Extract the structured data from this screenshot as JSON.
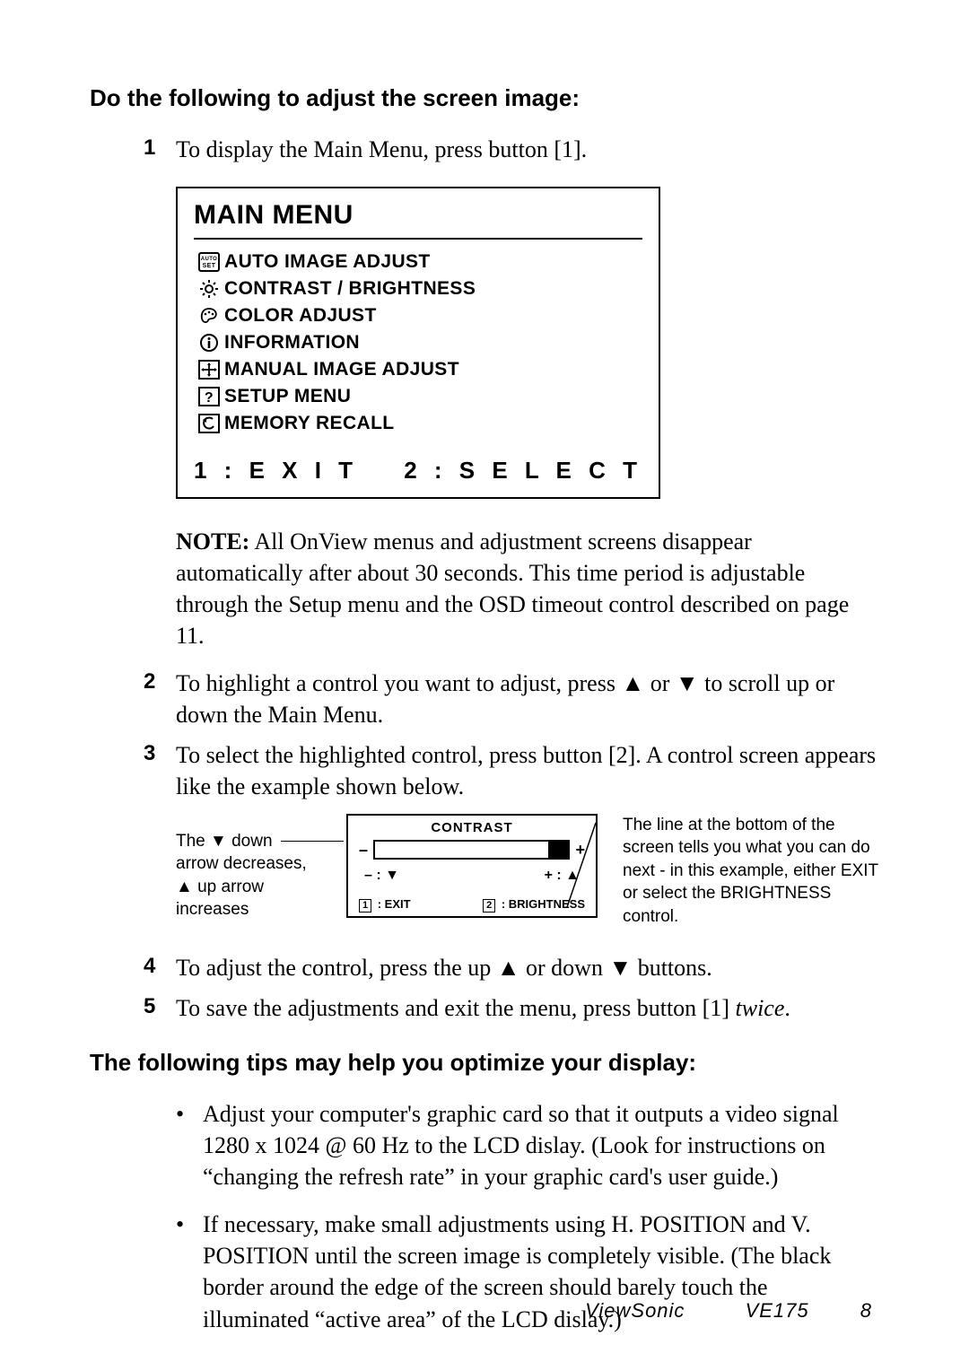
{
  "heading1": "Do the following to adjust the screen image:",
  "step1": {
    "n": "1",
    "text": "To display the Main Menu, press button [1]."
  },
  "menu": {
    "title": "MAIN MENU",
    "items": [
      {
        "icon": "autoset-icon",
        "label": "AUTO IMAGE ADJUST"
      },
      {
        "icon": "brightness-icon",
        "label": "CONTRAST / BRIGHTNESS"
      },
      {
        "icon": "palette-icon",
        "label": "COLOR ADJUST"
      },
      {
        "icon": "info-icon",
        "label": "INFORMATION"
      },
      {
        "icon": "move-icon",
        "label": "MANUAL IMAGE ADJUST"
      },
      {
        "icon": "help-icon",
        "label": "SETUP MENU"
      },
      {
        "icon": "recall-icon",
        "label": "MEMORY RECALL"
      }
    ],
    "foot_left": "1 : E X I T",
    "foot_right": "2 : S E L E C T"
  },
  "note_label": "NOTE:",
  "note_text": " All OnView menus and adjustment screens disappear automatically after about 30 seconds. This time period is adjustable through the Setup menu and the OSD timeout control described on page 11.",
  "step2": {
    "n": "2",
    "pre": "To highlight a control you want to adjust, press ",
    "mid": " or ",
    "post": " to scroll up or down the Main Menu."
  },
  "step3": {
    "n": "3",
    "text": "To select the highlighted control, press button [2]. A control screen appears like the example shown below."
  },
  "contrast": {
    "left_l1": "The ▼ down",
    "left_l2": "arrow decreases,",
    "left_l3": "▲ up arrow",
    "left_l4": "increases",
    "title": "CONTRAST",
    "minus": "–",
    "plus": "+",
    "hint_minus": "– : ▼",
    "hint_plus": "+ : ▲",
    "foot_exit_key": "1",
    "foot_exit": " : EXIT",
    "foot_br_key": "2",
    "foot_br": " : BRIGHTNESS",
    "right": "The line at the bottom of the screen tells you what you can do next - in this example, either EXIT or select the BRIGHTNESS control."
  },
  "step4": {
    "n": "4",
    "pre": "To adjust the control, press the up ",
    "mid": " or down ",
    "post": " buttons."
  },
  "step5": {
    "n": "5",
    "pre": "To save the adjustments and exit the menu, press button [1] ",
    "ital": "twice",
    "post": "."
  },
  "heading2": "The following tips may help you optimize your display:",
  "tip1": "Adjust your computer's graphic card so that it outputs a video signal 1280 x 1024 @ 60 Hz to the LCD dislay. (Look for instructions on “changing the refresh rate” in your graphic card's user guide.)",
  "tip2_pre": "If necessary, make small adjustments using H. POSITION and V. POSITION until the screen image is ",
  "tip2_u": "completely visible",
  "tip2_post": ". (The black border around the edge of the screen should barely touch the illuminated “active area” of the LCD dislay.)",
  "footer": {
    "brand": "ViewSonic",
    "model": "VE175",
    "page": "8"
  },
  "glyphs": {
    "up": "▲",
    "down": "▼",
    "bullet": "•"
  }
}
